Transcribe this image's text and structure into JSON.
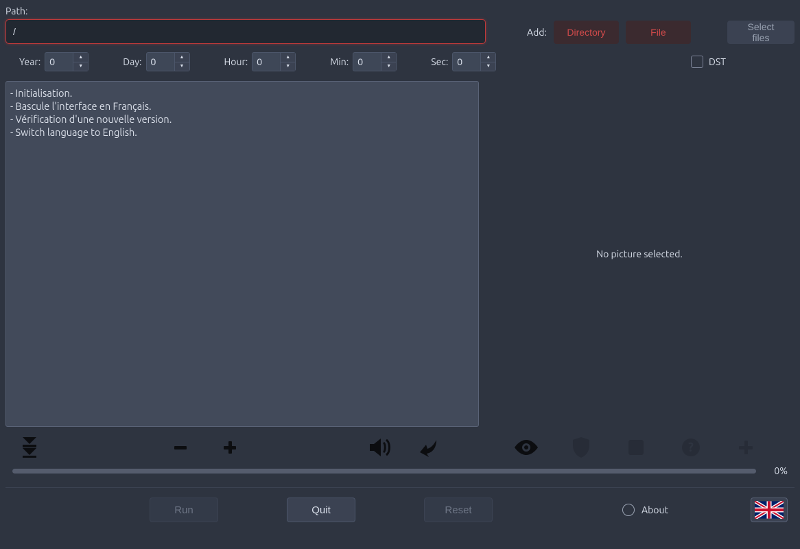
{
  "path": {
    "label": "Path:",
    "value": "/"
  },
  "add": {
    "label": "Add:",
    "directory_btn": "Directory",
    "file_btn": "File",
    "select_files_btn": "Select files"
  },
  "time": {
    "year": {
      "label": "Year:",
      "value": "0"
    },
    "day": {
      "label": "Day:",
      "value": "0"
    },
    "hour": {
      "label": "Hour:",
      "value": "0"
    },
    "min": {
      "label": "Min:",
      "value": "0"
    },
    "sec": {
      "label": "Sec:",
      "value": "0"
    },
    "dst": {
      "label": "DST",
      "checked": false
    }
  },
  "log": [
    "- Initialisation.",
    "- Bascule l'interface en Français.",
    "- Vérification d'une nouvelle version.",
    "- Switch language to English."
  ],
  "preview": {
    "empty_text": "No picture selected."
  },
  "progress": {
    "percent_text": "0%"
  },
  "bottom": {
    "run": "Run",
    "quit": "Quit",
    "reset": "Reset",
    "about": "About"
  },
  "icons": {
    "download": "download-stack-icon",
    "minus": "minus-icon",
    "plus": "plus-icon",
    "volume": "volume-icon",
    "undo": "undo-icon",
    "eye": "eye-icon",
    "shield": "shield-icon",
    "stop": "stop-icon",
    "help": "help-icon",
    "add": "add-icon"
  },
  "language": {
    "flag": "uk-flag"
  }
}
